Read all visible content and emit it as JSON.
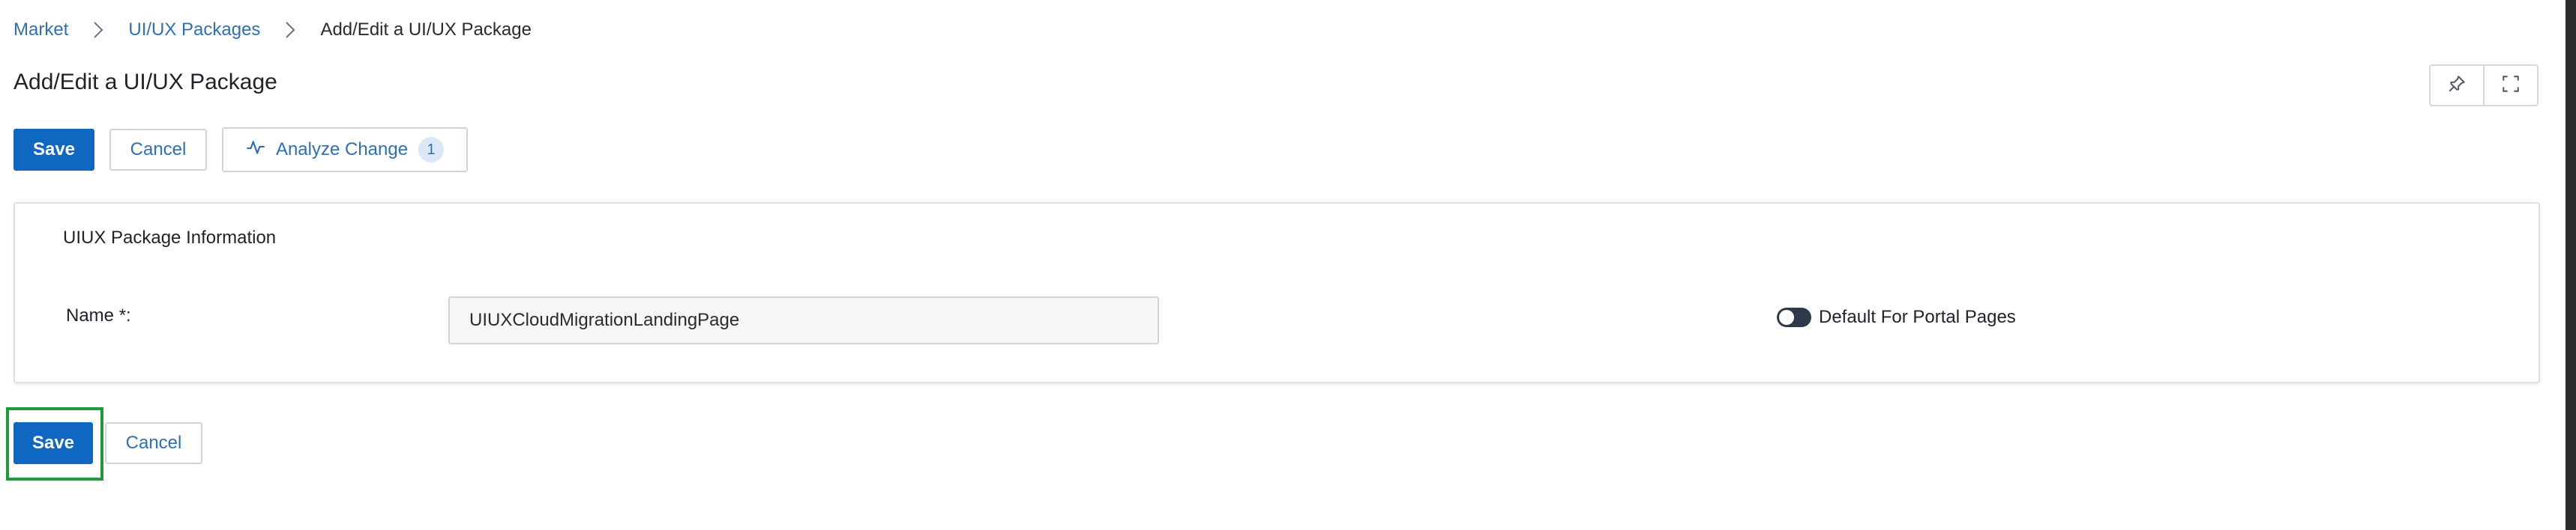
{
  "breadcrumb": {
    "items": [
      "Market",
      "UI/UX Packages"
    ],
    "current": "Add/Edit a UI/UX Package"
  },
  "page": {
    "title": "Add/Edit a UI/UX Package"
  },
  "toolbar": {
    "save_label": "Save",
    "cancel_label": "Cancel",
    "analyze_label": "Analyze Change",
    "analyze_count": "1"
  },
  "panel": {
    "title": "UIUX Package Information",
    "name_label": "Name *:",
    "name_value": "UIUXCloudMigrationLandingPage",
    "toggle_label": "Default For Portal Pages",
    "toggle_on": false
  },
  "footer": {
    "save_label": "Save",
    "cancel_label": "Cancel"
  },
  "icons": {
    "pin": "pin-icon",
    "fullscreen": "fullscreen-icon",
    "analyze": "activity-icon",
    "separator": "chevron-right-icon"
  },
  "colors": {
    "primary": "#0f67c2",
    "link": "#2f6fb5",
    "highlight": "#1e9a3b",
    "toggle": "#2e3a4b"
  }
}
